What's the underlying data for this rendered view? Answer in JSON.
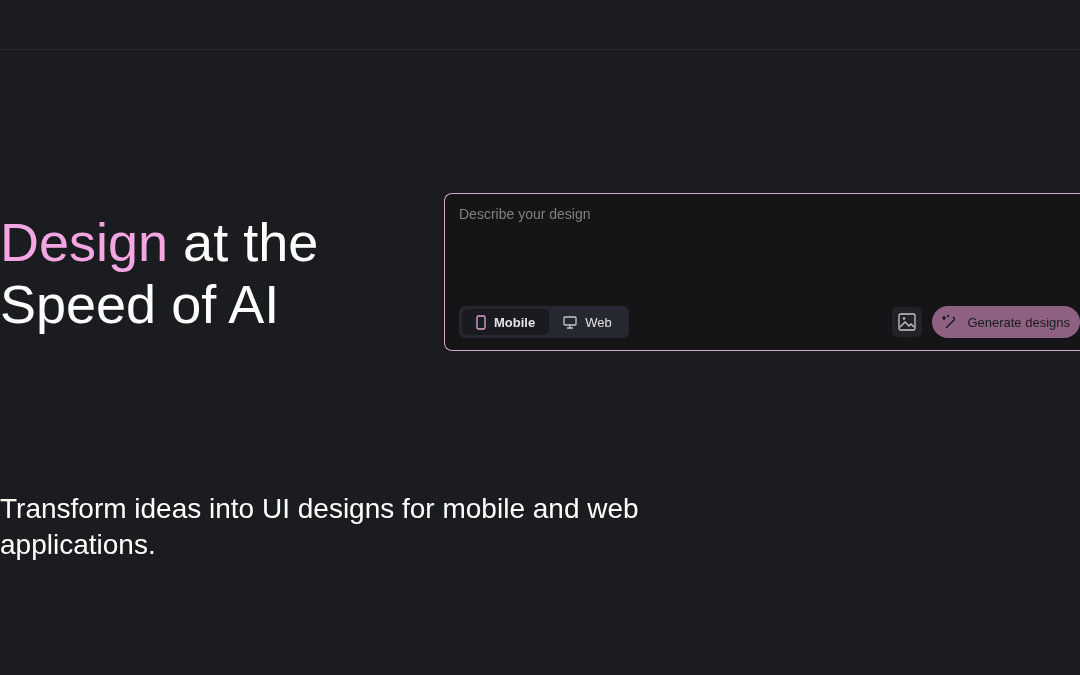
{
  "headline": {
    "accent": "Design",
    "rest": "at the Speed of AI"
  },
  "prompt": {
    "placeholder": "Describe your design",
    "modes": [
      {
        "label": "Mobile",
        "kind": "mobile",
        "selected": true
      },
      {
        "label": "Web",
        "kind": "web",
        "selected": false
      }
    ],
    "generate_button": "Generate designs"
  },
  "tagline": "Transform ideas into UI designs for mobile and web applications."
}
